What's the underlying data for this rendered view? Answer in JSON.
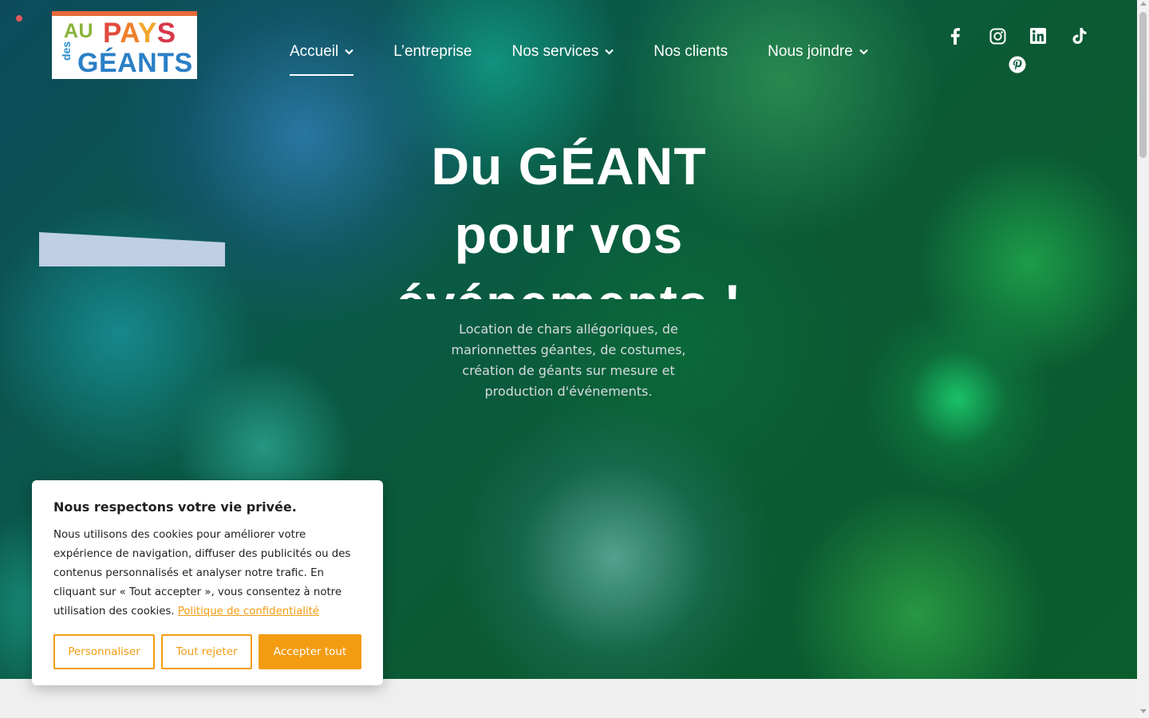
{
  "brand": {
    "logo_line1_small": "AU",
    "logo_pays_letters": [
      "P",
      "A",
      "Y",
      "S"
    ],
    "logo_des": "des",
    "logo_geants": "GÉANTS"
  },
  "nav": {
    "items": [
      {
        "label": "Accueil",
        "has_dropdown": true,
        "active": true
      },
      {
        "label": "L’entreprise",
        "has_dropdown": false,
        "active": false
      },
      {
        "label": "Nos services",
        "has_dropdown": true,
        "active": false
      },
      {
        "label": "Nos clients",
        "has_dropdown": false,
        "active": false
      },
      {
        "label": "Nous joindre",
        "has_dropdown": true,
        "active": false
      }
    ]
  },
  "social": [
    "facebook-icon",
    "instagram-icon",
    "linkedin-icon",
    "tiktok-icon",
    "pinterest-icon"
  ],
  "hero": {
    "title_line1": "Du GÉANT",
    "title_line2": "pour vos",
    "title_line3": "événements !",
    "subtitle": "Location de chars allégoriques, de marionnettes géantes, de costumes, création de géants sur mesure et production d'événements."
  },
  "cookie": {
    "title": "Nous respectons votre vie privée.",
    "text": "Nous utilisons des cookies pour améliorer votre expérience de navigation, diffuser des publicités ou des contenus personnalisés et analyser notre trafic. En cliquant sur « Tout accepter », vous consentez à notre utilisation des cookies.",
    "link": "Politique de confidentialité",
    "btn_customize": "Personnaliser",
    "btn_reject": "Tout rejeter",
    "btn_accept": "Accepter tout"
  },
  "colors": {
    "accent": "#f39c12",
    "logo_border": "#e76a3a"
  }
}
